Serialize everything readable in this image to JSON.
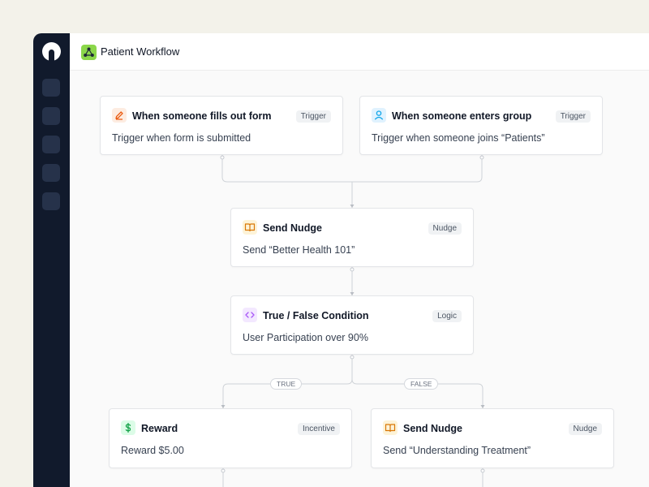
{
  "app": {
    "title": "Patient Workflow"
  },
  "icons": {
    "logo": "logo-icon",
    "app": "workflow-icon"
  },
  "nodes": [
    {
      "title": "When someone fills out form",
      "badge": "Trigger",
      "description": "Trigger when form is submitted",
      "icon": "pencil-icon",
      "icon_color": "#ea580c",
      "icon_bg": "#fdece1"
    },
    {
      "title": "When someone enters group",
      "badge": "Trigger",
      "description": "Trigger when someone joins “Patients”",
      "icon": "user-icon",
      "icon_color": "#0ea5e9",
      "icon_bg": "#e0f2fe"
    },
    {
      "title": "Send Nudge",
      "badge": "Nudge",
      "description": "Send “Better Health 101”",
      "icon": "book-icon",
      "icon_color": "#d97706",
      "icon_bg": "#fdf3d8"
    },
    {
      "title": "True / False Condition",
      "badge": "Logic",
      "description": "User Participation over 90%",
      "icon": "code-icon",
      "icon_color": "#a855f7",
      "icon_bg": "#f3e8ff"
    },
    {
      "title": "Reward",
      "badge": "Incentive",
      "description": "Reward $5.00",
      "icon": "dollar-icon",
      "icon_color": "#16a34a",
      "icon_bg": "#dcfce7"
    },
    {
      "title": "Send Nudge",
      "badge": "Nudge",
      "description": "Send “Understanding Treatment”",
      "icon": "book-icon",
      "icon_color": "#d97706",
      "icon_bg": "#fdf3d8"
    }
  ],
  "branches": {
    "true_label": "TRUE",
    "false_label": "FALSE"
  },
  "colors": {
    "sidebar": "#111a2c",
    "app_icon": "#8bd74a",
    "wire": "#cfd3d8"
  }
}
